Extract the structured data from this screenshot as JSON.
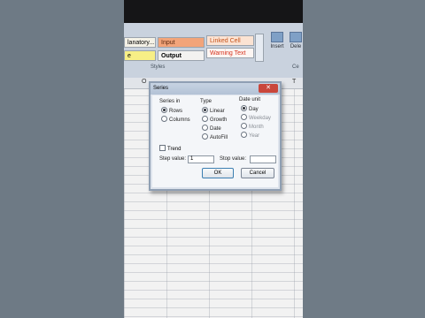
{
  "ribbon": {
    "cells": [
      {
        "label": "lanatory...",
        "bg": "#f4f1e6"
      },
      {
        "label": "Input",
        "bg": "#f2a47a"
      },
      {
        "label": "Linked Cell",
        "bg": "#fbe3d3"
      },
      {
        "label": "e",
        "bg": "#f7ef86"
      },
      {
        "label": "Output",
        "bg": "#f3f2f0"
      },
      {
        "label": "Warning Text",
        "bg": "#fdf6f3"
      }
    ],
    "styles_label": "Styles",
    "insert_label": "Insert",
    "delete_label": "Dele",
    "cells_group_label": "Ce"
  },
  "columns": [
    "O",
    "T"
  ],
  "dialog": {
    "title": "Series",
    "close_label": "✕",
    "series_in": {
      "title": "Series in",
      "options": [
        {
          "label": "Rows",
          "selected": true
        },
        {
          "label": "Columns",
          "selected": false
        }
      ]
    },
    "type": {
      "title": "Type",
      "options": [
        {
          "label": "Linear",
          "selected": true
        },
        {
          "label": "Growth",
          "selected": false
        },
        {
          "label": "Date",
          "selected": false
        },
        {
          "label": "AutoFill",
          "selected": false
        }
      ]
    },
    "date_unit": {
      "title": "Date unit",
      "options": [
        {
          "label": "Day",
          "selected": true
        },
        {
          "label": "Weekday",
          "selected": false
        },
        {
          "label": "Month",
          "selected": false
        },
        {
          "label": "Year",
          "selected": false
        }
      ]
    },
    "trend_label": "Trend",
    "step_value_label": "Step value:",
    "step_value": "1",
    "stop_value_label": "Stop value:",
    "stop_value": "",
    "ok_label": "OK",
    "cancel_label": "Cancel"
  }
}
